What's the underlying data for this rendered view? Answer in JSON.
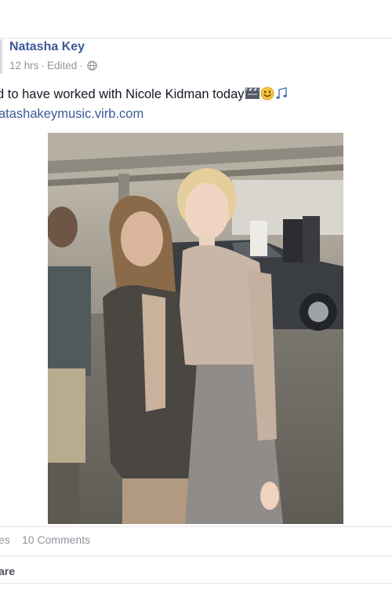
{
  "post": {
    "author": "Natasha Key",
    "time": "12 hrs",
    "separator": "·",
    "edited": "Edited",
    "text": "d to have worked with Nicole Kidman today",
    "link": "atashakeymusic.virb.com",
    "emojis": [
      "clapperboard-icon",
      "smiley-icon",
      "music-notes-icon"
    ]
  },
  "stats": {
    "likes": "es",
    "comments": "10 Comments"
  },
  "actions": {
    "share": "are"
  },
  "colors": {
    "link_blue": "#3b5998",
    "meta_grey": "#90949c",
    "text_dark": "#141823",
    "divider": "#e5e6e9"
  }
}
